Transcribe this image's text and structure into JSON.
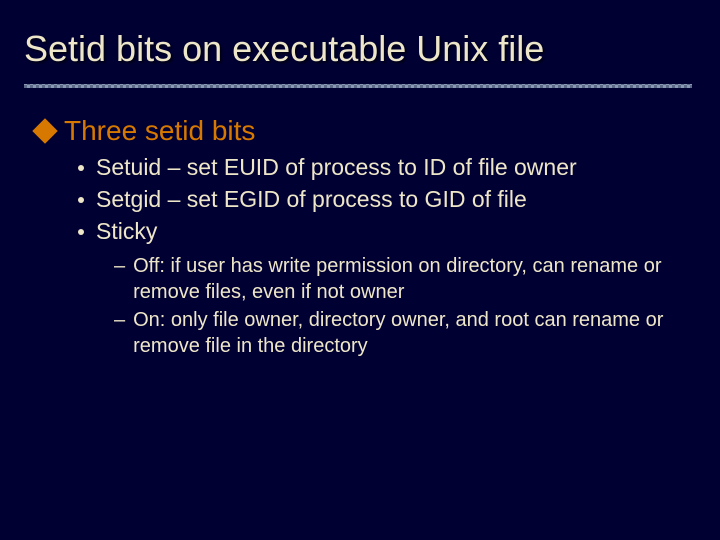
{
  "title": "Setid bits on executable Unix file",
  "heading": "Three setid bits",
  "bullets": [
    "Setuid – set EUID of process to ID of file owner",
    "Setgid – set EGID of process to GID of file",
    "Sticky"
  ],
  "subbullets": [
    "Off: if user has write permission on directory, can rename or remove files, even if not owner",
    "On: only file owner, directory owner, and root can rename or remove file in the directory"
  ],
  "colors": {
    "background": "#000033",
    "title": "#eee6c8",
    "accent": "#d77900",
    "body": "#eee6c8"
  }
}
